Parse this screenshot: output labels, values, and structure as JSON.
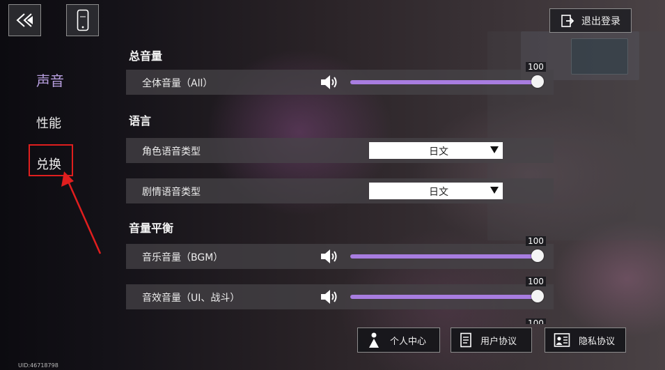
{
  "header": {
    "logout_label": "退出登录"
  },
  "nav": {
    "items": [
      {
        "label": "声音"
      },
      {
        "label": "性能"
      },
      {
        "label": "兑换"
      }
    ]
  },
  "sections": {
    "total": {
      "title": "总音量"
    },
    "language": {
      "title": "语言"
    },
    "balance": {
      "title": "音量平衡"
    }
  },
  "rows": {
    "all": {
      "label": "全体音量（All）",
      "value": "100"
    },
    "char_voice": {
      "label": "角色语音类型",
      "selected": "日文"
    },
    "story_voice": {
      "label": "剧情语音类型",
      "selected": "日文"
    },
    "bgm": {
      "label": "音乐音量（BGM）",
      "value": "100"
    },
    "se": {
      "label": "音效音量（UI、战斗）",
      "value": "100"
    },
    "next_partial_value": "100"
  },
  "footer": {
    "personal_center": "个人中心",
    "user_agreement": "用户协议",
    "privacy_agreement": "隐私协议"
  },
  "uid_text": "UID:46718798",
  "icons": {
    "back": "back-icon",
    "phone": "phone-icon",
    "logout": "logout-icon",
    "speaker": "speaker-icon",
    "dropdown": "triangle-down-icon",
    "person": "person-icon",
    "document": "document-icon",
    "privacy": "id-card-icon"
  },
  "colors": {
    "accent": "#a87de0",
    "active_nav": "#b89fe0",
    "highlight_box": "#e01e1e"
  }
}
